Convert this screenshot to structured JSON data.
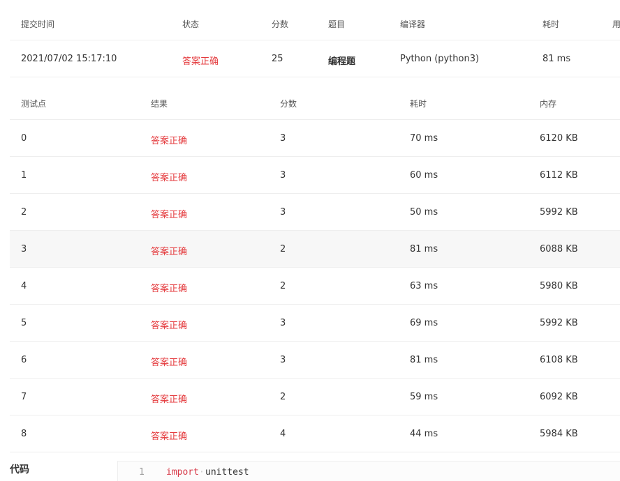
{
  "submission": {
    "headers": [
      "提交时间",
      "状态",
      "分数",
      "题目",
      "编译器",
      "耗时",
      "用"
    ],
    "row": {
      "time": "2021/07/02 15:17:10",
      "status": "答案正确",
      "score": "25",
      "problem": "编程题",
      "compiler": "Python (python3)",
      "elapsed": "81 ms"
    }
  },
  "testcases": {
    "headers": [
      "测试点",
      "结果",
      "分数",
      "耗时",
      "内存"
    ],
    "rows": [
      {
        "id": "0",
        "result": "答案正确",
        "score": "3",
        "time": "70 ms",
        "memory": "6120 KB"
      },
      {
        "id": "1",
        "result": "答案正确",
        "score": "3",
        "time": "60 ms",
        "memory": "6112 KB"
      },
      {
        "id": "2",
        "result": "答案正确",
        "score": "3",
        "time": "50 ms",
        "memory": "5992 KB"
      },
      {
        "id": "3",
        "result": "答案正确",
        "score": "2",
        "time": "81 ms",
        "memory": "6088 KB"
      },
      {
        "id": "4",
        "result": "答案正确",
        "score": "2",
        "time": "63 ms",
        "memory": "5980 KB"
      },
      {
        "id": "5",
        "result": "答案正确",
        "score": "3",
        "time": "69 ms",
        "memory": "5992 KB"
      },
      {
        "id": "6",
        "result": "答案正确",
        "score": "3",
        "time": "81 ms",
        "memory": "6108 KB"
      },
      {
        "id": "7",
        "result": "答案正确",
        "score": "2",
        "time": "59 ms",
        "memory": "6092 KB"
      },
      {
        "id": "8",
        "result": "答案正确",
        "score": "4",
        "time": "44 ms",
        "memory": "5984 KB"
      }
    ]
  },
  "code": {
    "label": "代码",
    "line_number": "1",
    "keyword": "import",
    "space_marker": "·",
    "module": "unittest"
  },
  "colors": {
    "accent_red": "#e4393c",
    "row_highlight": "#f7f7f7",
    "border": "#eeeeee"
  }
}
